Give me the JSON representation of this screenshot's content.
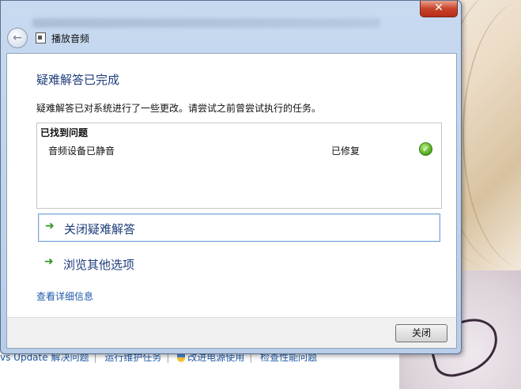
{
  "background": {
    "links": [
      "vs Update 解决问题",
      "运行维护任务",
      "改进电源使用",
      "检查性能问题"
    ]
  },
  "dialog": {
    "close_glyph": "✕",
    "nav_title": "播放音频",
    "heading": "疑难解答已完成",
    "description": "疑难解答已对系统进行了一些更改。请尝试之前曾尝试执行的任务。",
    "problems": {
      "header": "已找到问题",
      "items": [
        {
          "name": "音频设备已静音",
          "status": "已修复",
          "icon": "check-icon"
        }
      ]
    },
    "commands": [
      {
        "label": "关闭疑难解答"
      },
      {
        "label": "浏览其他选项"
      }
    ],
    "details_link": "查看详细信息",
    "close_button": "关闭"
  },
  "colors": {
    "heading": "#1e3d7b",
    "link": "#1e5aa8",
    "success": "#4aa61b"
  }
}
